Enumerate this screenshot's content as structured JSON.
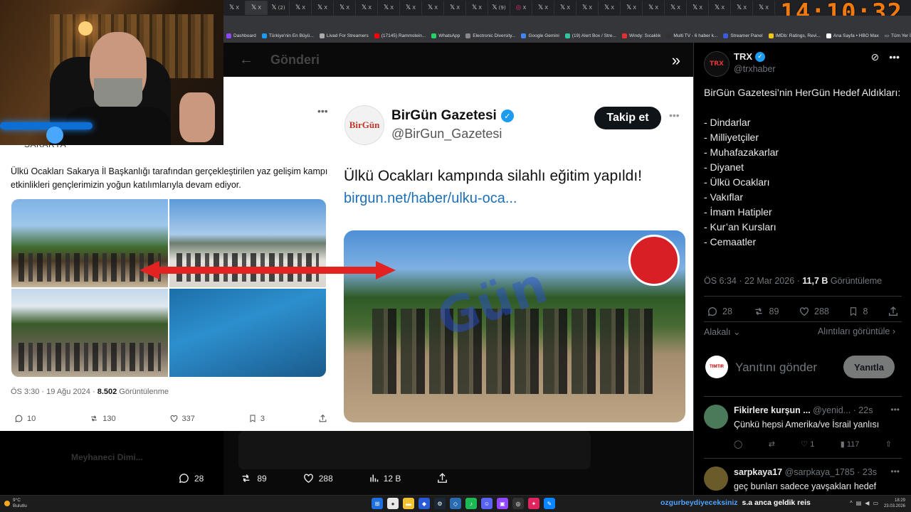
{
  "clock": "14:10:32",
  "tabs": {
    "items": [
      {
        "icon": "x-icon",
        "label": "X"
      },
      {
        "icon": "x-icon",
        "label": "X"
      },
      {
        "icon": "x-icon",
        "label": "(2)"
      },
      {
        "icon": "x-icon",
        "label": "X"
      },
      {
        "icon": "x-icon",
        "label": "X"
      },
      {
        "icon": "x-icon",
        "label": "X"
      },
      {
        "icon": "x-icon",
        "label": "X"
      },
      {
        "icon": "x-icon",
        "label": "X"
      },
      {
        "icon": "x-icon",
        "label": "X"
      },
      {
        "icon": "x-icon",
        "label": "X"
      },
      {
        "icon": "x-icon",
        "label": "X"
      },
      {
        "icon": "x-icon",
        "label": "X"
      },
      {
        "icon": "x-icon",
        "label": "(9)"
      },
      {
        "icon": "instagram-icon",
        "label": "X"
      },
      {
        "icon": "x-icon",
        "label": "X"
      },
      {
        "icon": "x-icon",
        "label": "X"
      },
      {
        "icon": "x-icon",
        "label": "X"
      },
      {
        "icon": "x-icon",
        "label": "X"
      },
      {
        "icon": "x-icon",
        "label": "X"
      },
      {
        "icon": "x-icon",
        "label": "X"
      },
      {
        "icon": "x-icon",
        "label": "X"
      },
      {
        "icon": "x-icon",
        "label": "X"
      },
      {
        "icon": "x-icon",
        "label": "X"
      },
      {
        "icon": "x-icon",
        "label": "X"
      },
      {
        "icon": "x-icon",
        "label": "X"
      }
    ]
  },
  "bookmarks": [
    {
      "label": "Dashboard",
      "color": "#9146ff"
    },
    {
      "label": "Türkiye'nin En Büyü...",
      "color": "#1d9bf0"
    },
    {
      "label": "Livad For Streamers",
      "color": "#aaaaaa"
    },
    {
      "label": "(17145) Rammstein...",
      "color": "#ff0000"
    },
    {
      "label": "WhatsApp",
      "color": "#25d366"
    },
    {
      "label": "Electronic Diversity...",
      "color": "#888888"
    },
    {
      "label": "Google Gemini",
      "color": "#4285f4"
    },
    {
      "label": "(19) Alert Box / Stre...",
      "color": "#31c3a2"
    },
    {
      "label": "Windy: Sıcaklık",
      "color": "#e03030"
    },
    {
      "label": "Multi TV - 6 haber k...",
      "color": "#333333"
    },
    {
      "label": "Streamer Panel",
      "color": "#3b5bdb"
    },
    {
      "label": "IMDb: Ratings, Revi...",
      "color": "#f5c518"
    },
    {
      "label": "Ana Sayfa • HBO Max",
      "color": "#ffffff"
    }
  ],
  "bookmarks_other": "Tüm Yer İşaretleri",
  "post_header": {
    "back": "←",
    "title": "Gönderi"
  },
  "composite": {
    "left": {
      "header": "SAKARYA",
      "text": "Ülkü Ocakları Sakarya İl Başkanlığı tarafından gerçekleştirilen yaz gelişim kampı etkinlikleri gençlerimizin yoğun katılımlarıyla devam ediyor.",
      "time": "ÖS 3:30 · 19 Ağu 2024 · ",
      "views": "8.502",
      "views_label": " Görüntülenme",
      "replies": "10",
      "reposts": "130",
      "likes": "337",
      "bookmarks": "3"
    },
    "right": {
      "avatar": "BirGün",
      "name": "BirGün Gazetesi",
      "handle": "@BirGun_Gazetesi",
      "follow": "Takip et",
      "text": "Ülkü Ocakları kampında silahlı eğitim yapıldı!",
      "link": "birgun.net/haber/ulku-oca...",
      "watermark": "Gün"
    }
  },
  "bottom_actions": {
    "replies": "28",
    "reposts": "89",
    "likes": "288",
    "views": "12 B"
  },
  "background_user": "Meyhaneci Dimi...",
  "detail": {
    "avatar": "TRX",
    "name": "TRX",
    "handle": "@trxhaber",
    "lines": [
      "BirGün Gazetesi’nin HerGün Hedef Aldıkları:",
      "",
      "- Dindarlar",
      "- Milliyetçiler",
      "- Muhafazakarlar",
      "- Diyanet",
      "- Ülkü Ocakları",
      "- Vakıflar",
      "- İmam Hatipler",
      "- Kur’an Kursları",
      "- Cemaatler"
    ],
    "time": "ÖS 6:34 · 22 Mar 2026 · ",
    "views": "11,7 B",
    "views_label": " Görüntüleme",
    "replies": "28",
    "reposts": "89",
    "likes": "288",
    "bookmarks": "8",
    "sort": "Alakalı",
    "quotes": "Alıntıları görüntüle",
    "reply_avatar": "TIMTIR",
    "reply_placeholder": "Yanıtını gönder",
    "reply_button": "Yanıtla"
  },
  "comments": [
    {
      "name": "Fikirlere kurşun ...",
      "handle": "@yenid...",
      "time": "· 22s",
      "text": "Çünkü hepsi Amerika/ve İsrail yanlısı",
      "likes": "1",
      "views": "117",
      "avatar_color": "#4a7a5a"
    },
    {
      "name": "sarpkaya17",
      "handle": "@sarpkaya_1785",
      "time": "· 23s",
      "text": "geç bunları sadece yavşakları hedef",
      "avatar_color": "#6b5a2a"
    }
  ],
  "taskbar": {
    "weather_temp": "9°C",
    "weather_label": "Bulutlu",
    "ticker_user": "ozgurbeydiyeceksiniz",
    "ticker_msg": "s.a anca geldik reis",
    "time": "18:29",
    "date": "23.03.2026"
  }
}
